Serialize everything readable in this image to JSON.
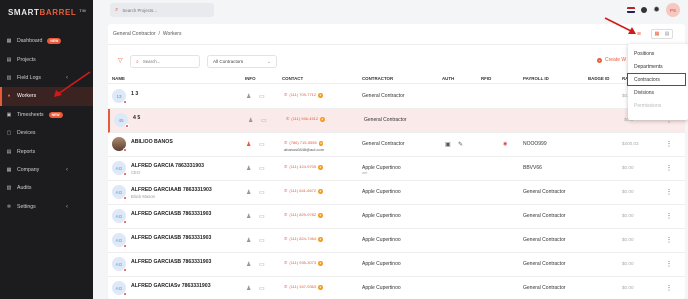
{
  "brand": {
    "part1": "SMART",
    "part2": "BARREL",
    "tm": "TM"
  },
  "sidebar": {
    "items": [
      {
        "label": "Dashboard",
        "icon": "dashboard-icon",
        "glyph": "▦",
        "badge": "NEW"
      },
      {
        "label": "Projects",
        "icon": "projects-icon",
        "glyph": "▤"
      },
      {
        "label": "Field Logs",
        "icon": "field-logs-icon",
        "glyph": "▥",
        "chevron": "‹"
      },
      {
        "label": "Workers",
        "icon": "workers-icon",
        "glyph": "●",
        "active": true
      },
      {
        "label": "Timesheets",
        "icon": "timesheets-icon",
        "glyph": "▣",
        "badge": "NEW"
      },
      {
        "label": "Devices",
        "icon": "devices-icon",
        "glyph": "▢"
      },
      {
        "label": "Reports",
        "icon": "reports-icon",
        "glyph": "▤"
      },
      {
        "label": "Company",
        "icon": "company-icon",
        "glyph": "▦",
        "chevron": "‹"
      },
      {
        "label": "Audits",
        "icon": "audits-icon",
        "glyph": "▧"
      },
      {
        "label": "Settings",
        "icon": "settings-icon",
        "glyph": "✲",
        "chevron": "‹"
      }
    ]
  },
  "topbar": {
    "search_placeholder": "Search Projects...",
    "avatar_initials": "PS"
  },
  "breadcrumb": {
    "parent": "General Contractor",
    "sep": "/",
    "current": "Workers"
  },
  "filters": {
    "search_placeholder": "Search...",
    "contractor_select": "All Contractors",
    "create_label": "Create W"
  },
  "table": {
    "headers": {
      "name": "NAME",
      "info": "INFO",
      "contact": "CONTACT",
      "contractor": "CONTRACTOR",
      "auth": "AUTH",
      "rfid": "RFID",
      "payroll": "PAYROLL ID",
      "badge": "BADGE ID",
      "rate": "RA"
    },
    "rows": [
      {
        "initials": "13",
        "name": "1 3",
        "sub": "",
        "phone": "(111) 709-7712",
        "email": "",
        "contractor": "General Contractor",
        "contractor_sub": "",
        "payroll": "",
        "badge": "",
        "rate": "$0.0"
      },
      {
        "initials": "45",
        "name": "4 5",
        "sub": "",
        "phone": "(111) 946-4512",
        "email": "",
        "contractor": "General Contractor",
        "contractor_sub": "",
        "payroll": "",
        "badge": "",
        "rate": "$0.0"
      },
      {
        "initials": "",
        "name": "ABILIOO BANOS",
        "sub": "",
        "phone": "(786) 715-5555",
        "email": "abanos0848@aol.com",
        "contractor": "General Contractor",
        "contractor_sub": "",
        "payroll": "NOOO999",
        "badge": "",
        "rate": "$400.03"
      },
      {
        "initials": "AG",
        "name": "ALFRED GARCIA 7863331903",
        "sub": "CEO",
        "phone": "(111) 424-9705",
        "email": "",
        "contractor": "Apple Cupertinoo",
        "contractor_sub": "aet",
        "payroll": "BBVV66",
        "badge": "",
        "rate": "$0.00"
      },
      {
        "initials": "AG",
        "name": "ALFRED GARCIAAB 7863331903",
        "sub": "Block Mason",
        "phone": "(111) 641-6672",
        "email": "",
        "contractor": "Apple Cupertinoo",
        "contractor_sub": "",
        "payroll": "General Contractor",
        "badge": "",
        "rate": "$0.00"
      },
      {
        "initials": "AG",
        "name": "ALFRED GARCIASB 7863331903",
        "sub": "",
        "phone": "(111) 829-9782",
        "email": "",
        "contractor": "Apple Cupertinoo",
        "contractor_sub": "",
        "payroll": "General Contractor",
        "badge": "",
        "rate": "$0.00"
      },
      {
        "initials": "AG",
        "name": "ALFRED GARCIASB 7863331903",
        "sub": "",
        "phone": "(111) 824-7464",
        "email": "",
        "contractor": "Apple Cupertinoo",
        "contractor_sub": "",
        "payroll": "General Contractor",
        "badge": "",
        "rate": "$0.00"
      },
      {
        "initials": "AG",
        "name": "ALFRED GARCIASB 7863331903",
        "sub": "",
        "phone": "(111) 935-3073",
        "email": "",
        "contractor": "Apple Cupertinoo",
        "contractor_sub": "",
        "payroll": "General Contractor",
        "badge": "",
        "rate": "$0.00"
      },
      {
        "initials": "AG",
        "name": "ALFRED GARCIASv 7863331903",
        "sub": "",
        "phone": "(111) 347-9363",
        "email": "",
        "contractor": "Apple Cupertinoo",
        "contractor_sub": "",
        "payroll": "General Contractor",
        "badge": "",
        "rate": "$0.00"
      }
    ]
  },
  "dropdown": {
    "items": [
      {
        "label": "Positions"
      },
      {
        "label": "Departments"
      },
      {
        "label": "Contractors",
        "selected": true
      },
      {
        "label": "Divisions"
      },
      {
        "label": "Permissions",
        "disabled": true
      }
    ]
  },
  "colors": {
    "accent": "#e85b3a",
    "sidebar_bg": "#1c1c1e",
    "annotation": "#d21a1a"
  }
}
